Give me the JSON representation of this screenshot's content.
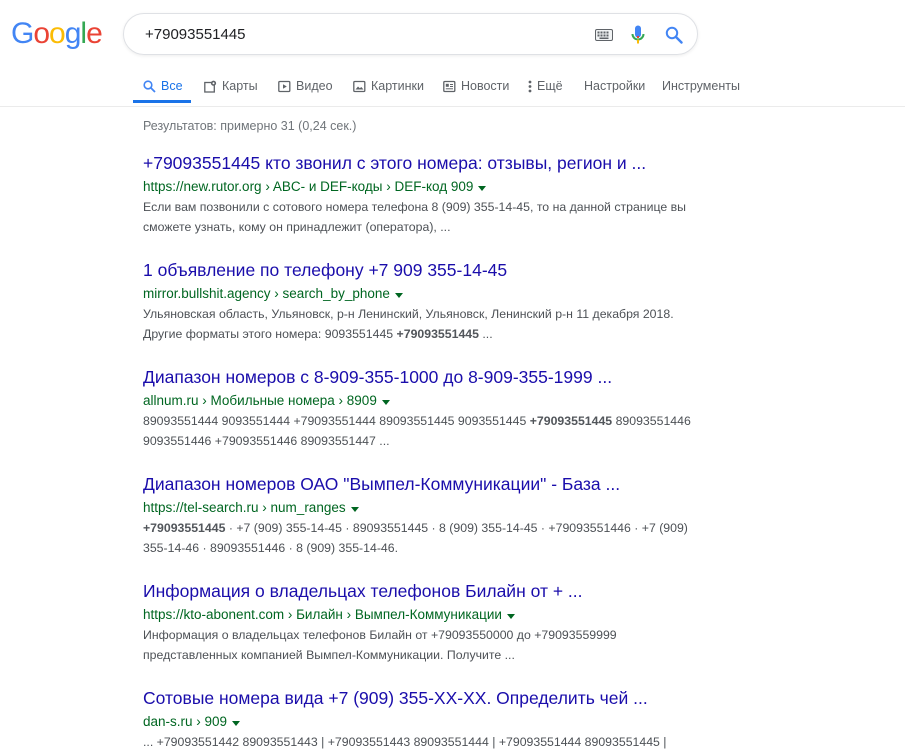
{
  "logo": {
    "letters": [
      "G",
      "o",
      "o",
      "g",
      "l",
      "e"
    ],
    "colors": [
      "#4285F4",
      "#EA4335",
      "#FBBC05",
      "#4285F4",
      "#34A853",
      "#EA4335"
    ]
  },
  "search": {
    "query": "+79093551445"
  },
  "tabs": [
    {
      "label": "Все",
      "icon": "search-icon",
      "active": true
    },
    {
      "label": "Карты",
      "icon": "map-pin-icon"
    },
    {
      "label": "Видео",
      "icon": "video-icon"
    },
    {
      "label": "Картинки",
      "icon": "image-icon"
    },
    {
      "label": "Новости",
      "icon": "news-icon"
    },
    {
      "label": "Ещё",
      "icon": "more-vert-icon"
    },
    {
      "label": "Настройки"
    },
    {
      "label": "Инструменты"
    }
  ],
  "stats": "Результатов: примерно 31 (0,24 сек.)",
  "results": [
    {
      "title": "+79093551445 кто звонил с этого номера: отзывы, регион и ...",
      "url": "https://new.rutor.org › ABC- и DEF-коды › DEF-код 909",
      "snippet": [
        {
          "text": "Если вам позвонили с сотового номера телефона 8 (909) 355-14-45, то на данной странице вы сможете узнать, кому он принадлежит (оператора), ..."
        }
      ]
    },
    {
      "title": "1 объявление по телефону +7 909 355-14-45",
      "url": "mirror.bullshit.agency › search_by_phone",
      "snippet": [
        {
          "text": "Ульяновская область, Ульяновск, р-н Ленинский, Ульяновск, Ленинский р-н 11 декабря 2018. Другие форматы этого номера: 9093551445 "
        },
        {
          "text": "+79093551445",
          "bold": true
        },
        {
          "text": " ..."
        }
      ]
    },
    {
      "title": "Диапазон номеров с 8-909-355-1000 до 8-909-355-1999 ...",
      "url": "allnum.ru › Мобильные номера › 8909",
      "snippet": [
        {
          "text": "89093551444 9093551444 +79093551444 89093551445 9093551445 "
        },
        {
          "text": "+79093551445",
          "bold": true
        },
        {
          "text": " 89093551446 9093551446 +79093551446 89093551447 ..."
        }
      ]
    },
    {
      "title": "Диапазон номеров ОАО \"Вымпел-Коммуникации\" - База ...",
      "url": "https://tel-search.ru › num_ranges",
      "snippet": [
        {
          "text": "+79093551445",
          "bold": true
        },
        {
          "text": " · +7 (909) 355-14-45 · 89093551445 · 8 (909) 355-14-45 · +79093551446 · +7 (909) 355-14-46 · 89093551446 · 8 (909) 355-14-46."
        }
      ]
    },
    {
      "title": "Информация о владельцах телефонов Билайн от + ...",
      "url": "https://kto-abonent.com › Билайн › Вымпел-Коммуникации",
      "snippet": [
        {
          "text": "Информация о владельцах телефонов Билайн от +79093550000 до +79093559999 представленных компанией Вымпел-Коммуникации. Получите ..."
        }
      ]
    },
    {
      "title": "Сотовые номера вида +7 (909) 355-XX-XX. Определить чей ...",
      "url": "dan-s.ru › 909",
      "snippet": [
        {
          "text": "... +79093551442 89093551443 | +79093551443 89093551444 | +79093551444 89093551445 |"
        }
      ]
    }
  ],
  "colors": {
    "link": "#1a0dab",
    "url": "#006621",
    "accent": "#1a73e8",
    "muted": "#70757a"
  }
}
